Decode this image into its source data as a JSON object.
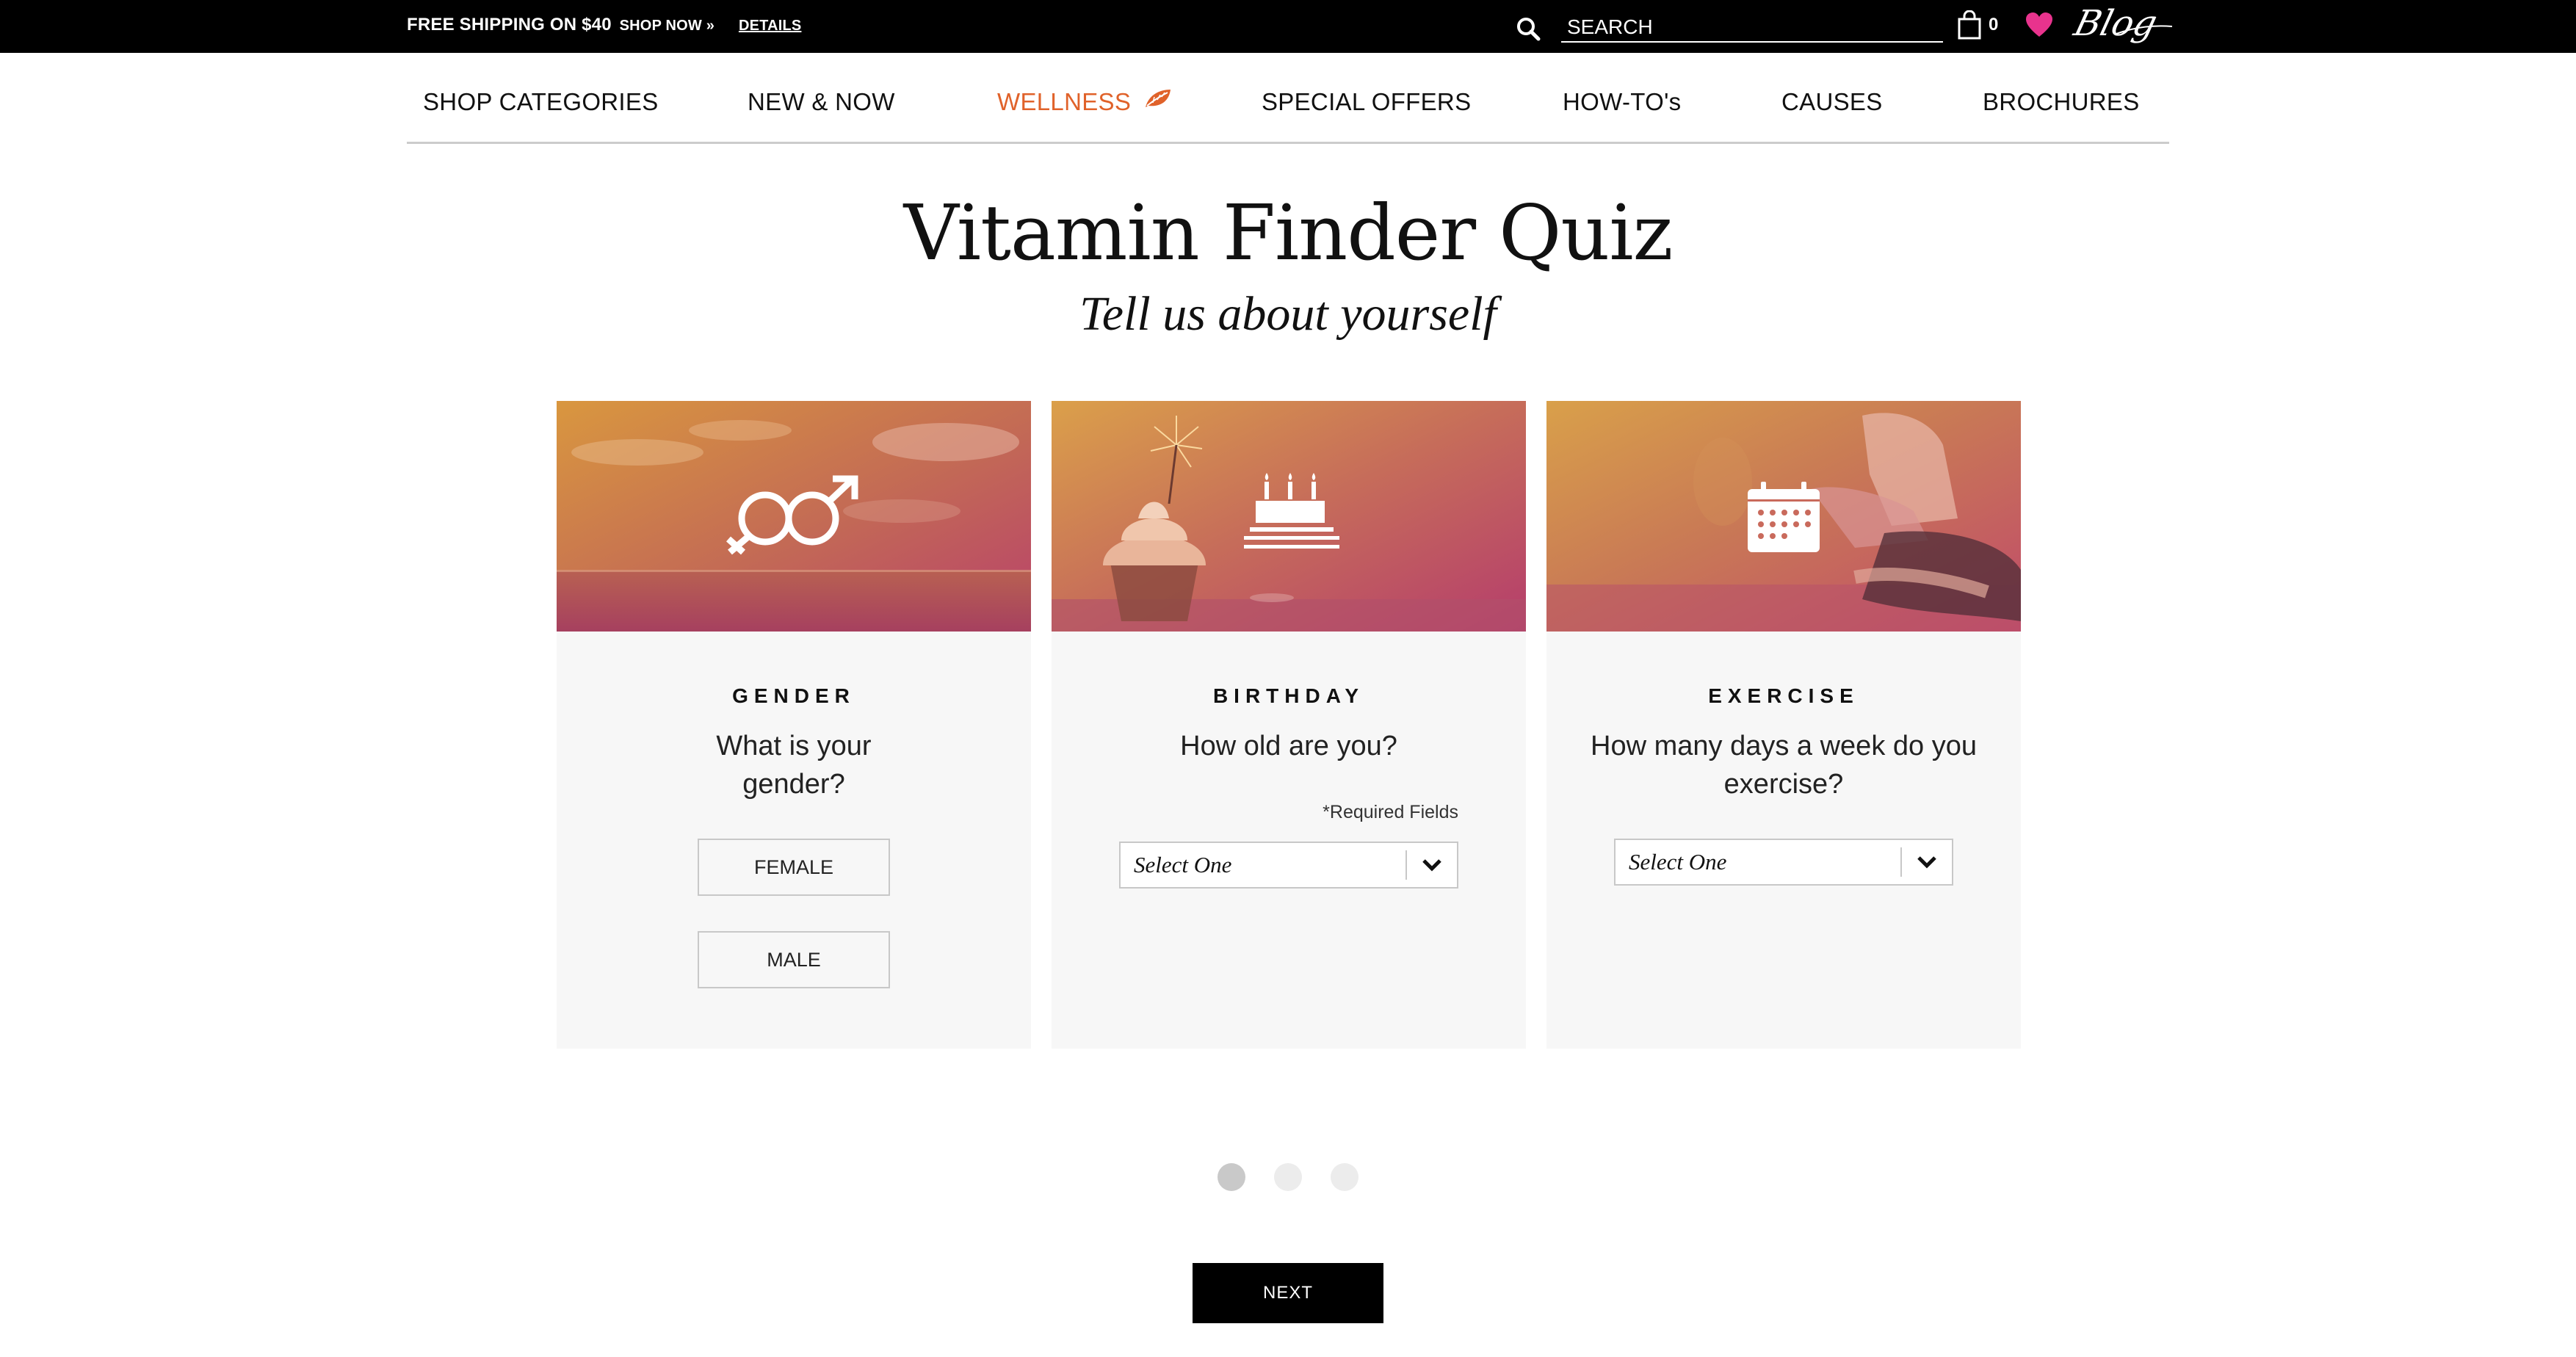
{
  "topbar": {
    "promo_text": "FREE SHIPPING ON $40",
    "shop_now": "SHOP NOW »",
    "details": "DETAILS",
    "search_placeholder": "SEARCH",
    "cart_count": "0",
    "blog_label": "Blog",
    "heart_color": "#e8338d"
  },
  "nav": {
    "items": [
      {
        "label": "SHOP CATEGORIES"
      },
      {
        "label": "NEW & NOW"
      },
      {
        "label": "WELLNESS",
        "active": true,
        "icon": "leaf-icon"
      },
      {
        "label": "SPECIAL OFFERS"
      },
      {
        "label": "HOW-TO's"
      },
      {
        "label": "CAUSES"
      },
      {
        "label": "BROCHURES"
      }
    ],
    "active_color": "#e0622a"
  },
  "quiz": {
    "title": "Vitamin Finder Quiz",
    "subtitle": "Tell us about yourself",
    "cards": [
      {
        "label": "GENDER",
        "question": "What is your gender?",
        "icon": "gender-symbols-icon",
        "options": [
          "FEMALE",
          "MALE"
        ]
      },
      {
        "label": "BIRTHDAY",
        "question": "How old are you?",
        "icon": "birthday-cake-icon",
        "required_note": "*Required Fields",
        "select_value": "Select One"
      },
      {
        "label": "EXERCISE",
        "question": "How many days a week do you exercise?",
        "icon": "calendar-icon",
        "select_value": "Select One"
      }
    ],
    "pagination": {
      "total": 3,
      "current": 1
    },
    "next_label": "NEXT"
  }
}
